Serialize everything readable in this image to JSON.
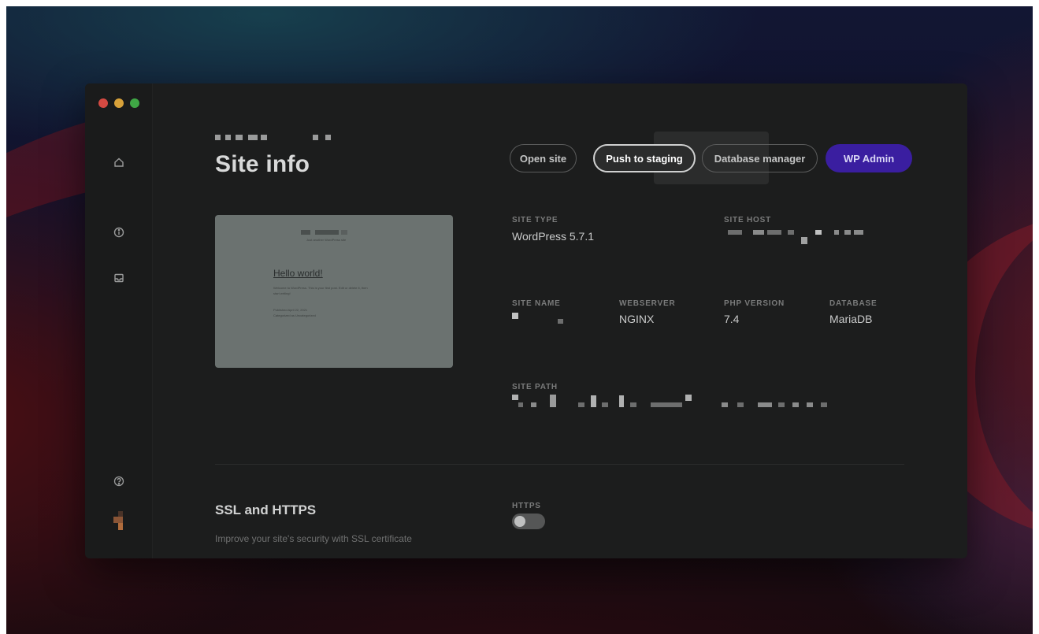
{
  "window": {
    "title": "Site info"
  },
  "actions": {
    "open_site": "Open site",
    "push_to_staging": "Push to staging",
    "database_manager": "Database manager",
    "wp_admin": "WP Admin"
  },
  "preview": {
    "subtitle": "Just another WordPress site",
    "post_title": "Hello world!",
    "post_excerpt_1": "Welcome to WordPress. This is your first post. Edit or delete it, then",
    "post_excerpt_2": "start writing!",
    "meta_1": "Published April 22, 2021",
    "meta_2": "Categorized as Uncategorized"
  },
  "site_info": {
    "site_type": {
      "label": "SITE TYPE",
      "value": "WordPress 5.7.1"
    },
    "site_host": {
      "label": "SITE HOST"
    },
    "site_name": {
      "label": "SITE NAME"
    },
    "webserver": {
      "label": "WEBSERVER",
      "value": "NGINX"
    },
    "php_version": {
      "label": "PHP VERSION",
      "value": "7.4"
    },
    "database": {
      "label": "DATABASE",
      "value": "MariaDB"
    },
    "site_path": {
      "label": "SITE PATH"
    }
  },
  "ssl": {
    "title": "SSL and HTTPS",
    "description": "Improve your site's security with SSL certificate",
    "https_label": "HTTPS",
    "https_enabled": false
  },
  "sidebar": {
    "icons": [
      "home-icon",
      "info-icon",
      "mail-icon",
      "help-icon"
    ]
  },
  "colors": {
    "accent": "#3a1ea0",
    "window_bg": "#1c1d1d",
    "traffic_red": "#d54a42",
    "traffic_yellow": "#d8a23a",
    "traffic_green": "#3fa745"
  }
}
